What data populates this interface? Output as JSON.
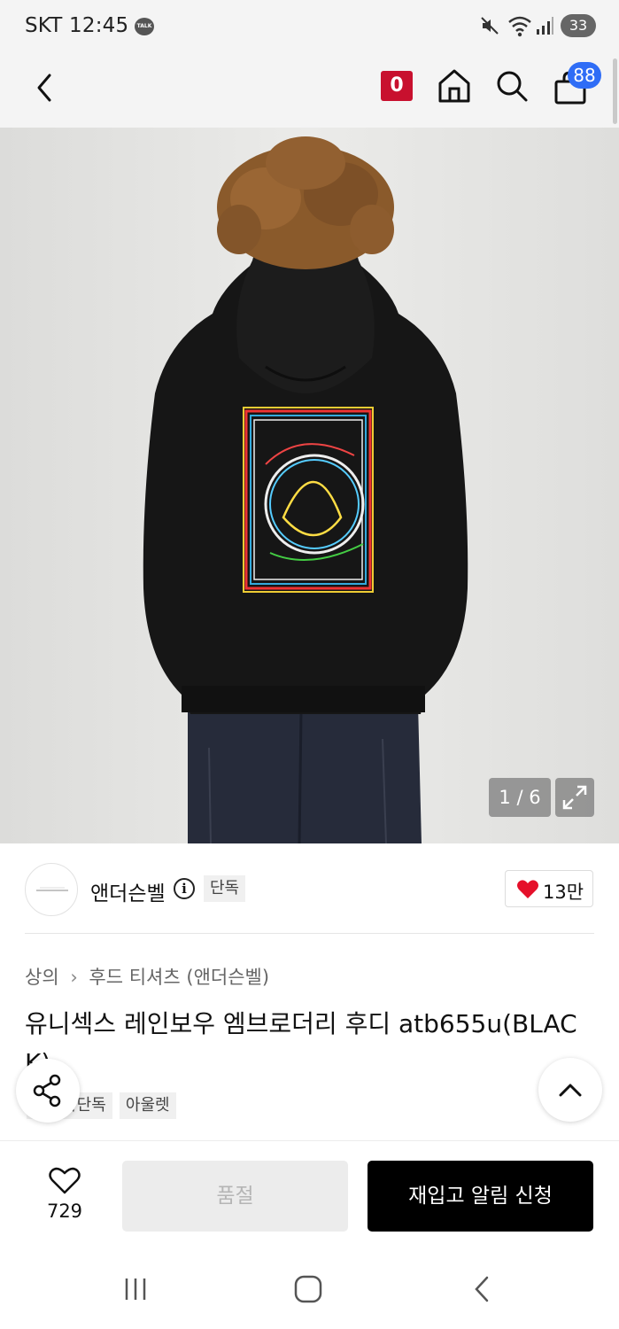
{
  "status_bar": {
    "carrier": "SKT 12:45",
    "talk_badge": "TALK",
    "battery": "33"
  },
  "header": {
    "point_badge": "0",
    "cart_count": "88"
  },
  "product_image": {
    "counter": "1 / 6",
    "current_index": 1,
    "total": 6
  },
  "brand": {
    "logo_text": "ADSB ANDERSSON BELL",
    "name": "앤더슨벨",
    "exclusive_tag": "단독",
    "like_count": "13만"
  },
  "breadcrumb": {
    "category": "상의",
    "subcategory": "후드 티셔츠 (앤더슨벨)"
  },
  "product": {
    "title": "유니섹스 레인보우 엠브로더리 후디 atb655u(BLACK)",
    "tags": [
      "무신사단독",
      "아울렛"
    ]
  },
  "bottom_bar": {
    "wish_count": "729",
    "soldout_label": "품절",
    "restock_label": "재입고 알림 신청"
  },
  "colors": {
    "accent_red": "#c8102e",
    "cart_badge_blue": "#2f6df6",
    "primary_button": "#000000"
  }
}
